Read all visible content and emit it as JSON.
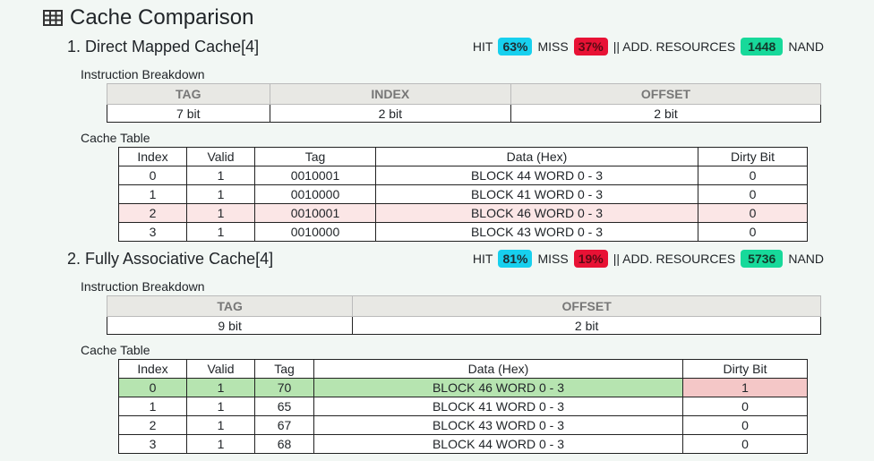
{
  "page": {
    "title": "Cache Comparison"
  },
  "colors": {
    "hit": "#17d0ee",
    "miss": "#e81235",
    "resources": "#17d99a",
    "highlight_red": "#fbe6e6",
    "highlight_green": "#b6e4b0",
    "dirty_red": "#f4c7c7"
  },
  "icons": {
    "title": "table-icon"
  },
  "sections": [
    {
      "title": "1. Direct Mapped Cache[4]",
      "stats": {
        "hit_label": "HIT",
        "hit_value": "63%",
        "miss_label": "MISS",
        "miss_value": "37%",
        "res_label": "|| ADD. RESOURCES",
        "res_value": "1448",
        "res_unit": "NAND"
      },
      "breakdown_label": "Instruction Breakdown",
      "breakdown_headers": [
        "TAG",
        "INDEX",
        "OFFSET"
      ],
      "breakdown_values": [
        "7 bit",
        "2 bit",
        "2 bit"
      ],
      "table_label": "Cache Table",
      "columns": [
        "Index",
        "Valid",
        "Tag",
        "Data (Hex)",
        "Dirty Bit"
      ],
      "rows": [
        [
          "0",
          "1",
          "0010001",
          "BLOCK 44 WORD 0 - 3",
          "0"
        ],
        [
          "1",
          "1",
          "0010000",
          "BLOCK 41 WORD 0 - 3",
          "0"
        ],
        [
          "2",
          "1",
          "0010001",
          "BLOCK 46 WORD 0 - 3",
          "0"
        ],
        [
          "3",
          "1",
          "0010000",
          "BLOCK 43 WORD 0 - 3",
          "0"
        ]
      ]
    },
    {
      "title": "2. Fully Associative Cache[4]",
      "stats": {
        "hit_label": "HIT",
        "hit_value": "81%",
        "miss_label": "MISS",
        "miss_value": "19%",
        "res_label": "|| ADD. RESOURCES",
        "res_value": "5736",
        "res_unit": "NAND"
      },
      "breakdown_label": "Instruction Breakdown",
      "breakdown_headers": [
        "TAG",
        "OFFSET"
      ],
      "breakdown_values": [
        "9 bit",
        "2 bit"
      ],
      "table_label": "Cache Table",
      "columns": [
        "Index",
        "Valid",
        "Tag",
        "Data (Hex)",
        "Dirty Bit"
      ],
      "rows": [
        [
          "0",
          "1",
          "70",
          "BLOCK 46 WORD 0 - 3",
          "1"
        ],
        [
          "1",
          "1",
          "65",
          "BLOCK 41 WORD 0 - 3",
          "0"
        ],
        [
          "2",
          "1",
          "67",
          "BLOCK 43 WORD 0 - 3",
          "0"
        ],
        [
          "3",
          "1",
          "68",
          "BLOCK 44 WORD 0 - 3",
          "0"
        ]
      ]
    }
  ]
}
